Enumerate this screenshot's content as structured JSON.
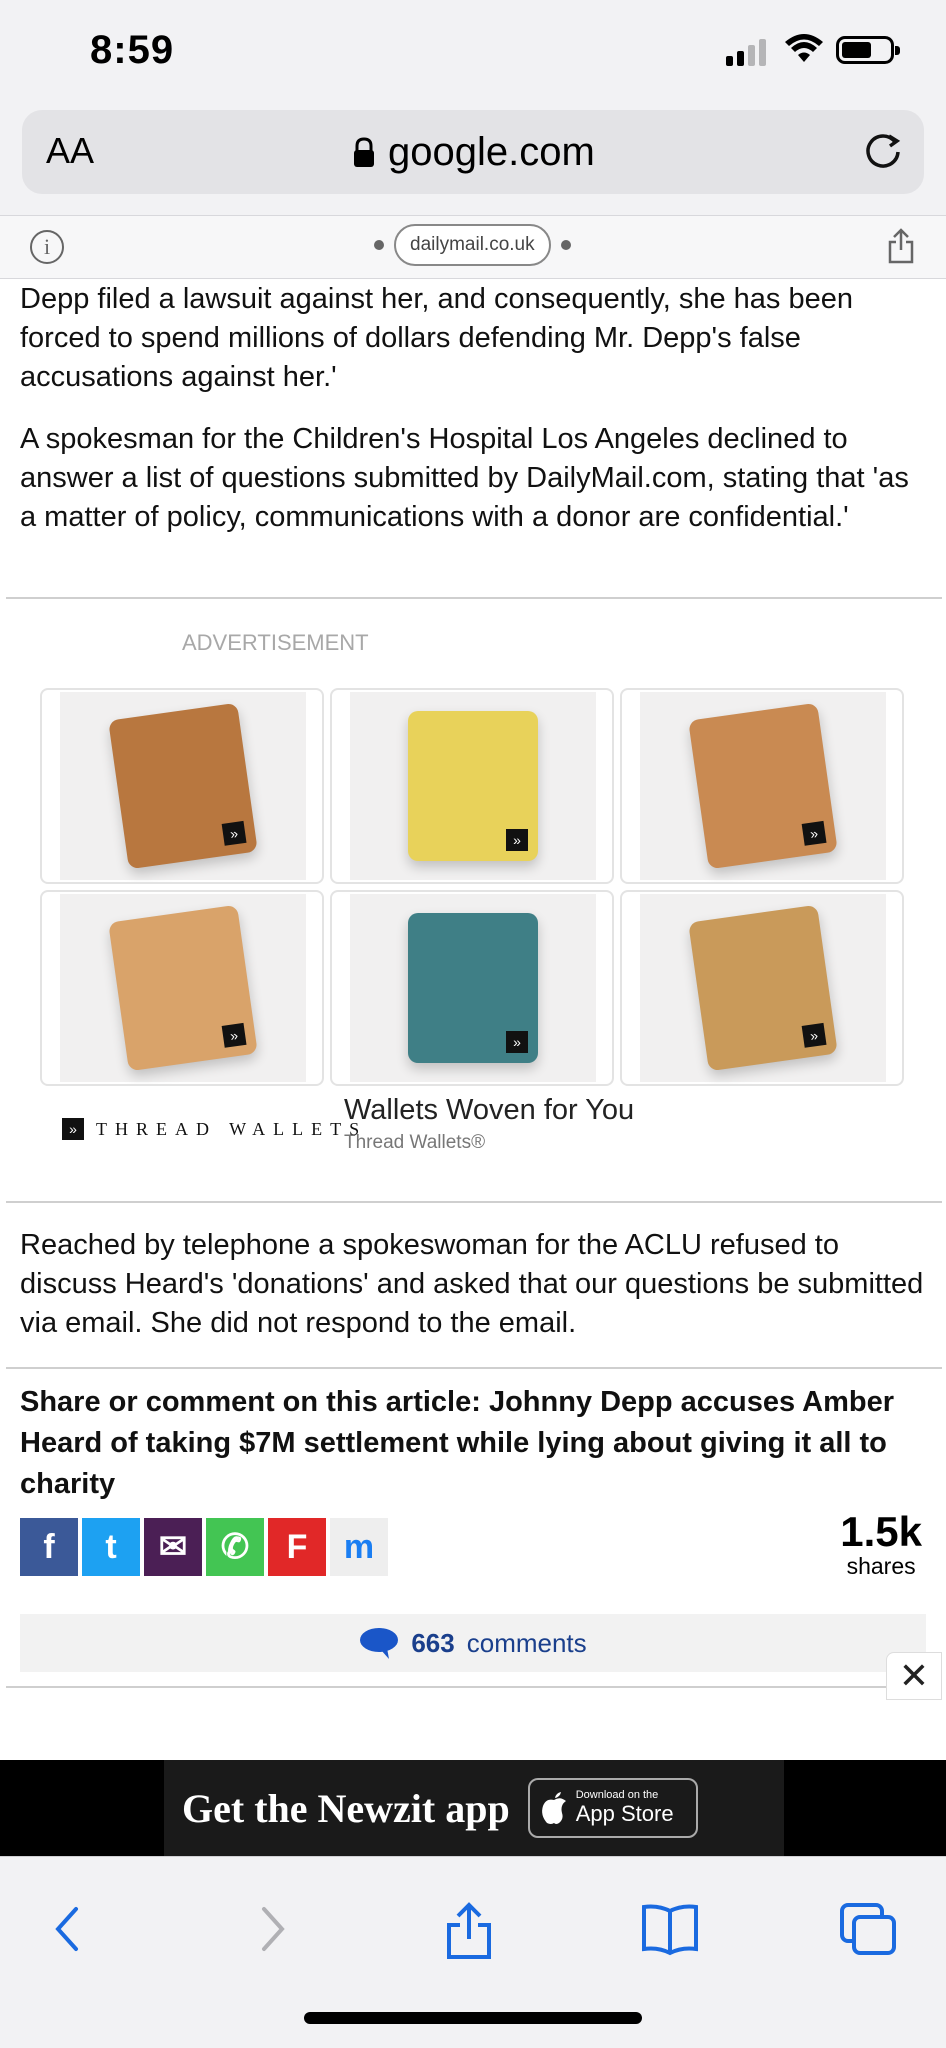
{
  "status": {
    "time": "8:59"
  },
  "browser": {
    "text_size_button": "AA",
    "url": "google.com",
    "site_pill": "dailymail.co.uk"
  },
  "article": {
    "p1": "Depp filed a lawsuit against her, and consequently, she has been forced to spend millions of dollars defending Mr. Depp's false accusations against her.'",
    "p2": "A spokesman for the Children's Hospital Los Angeles declined to answer a list of questions submitted by DailyMail.com, stating that 'as a matter of policy, communications with a donor are confidential.'",
    "p3": "Reached by telephone a spokeswoman for the ACLU refused to discuss Heard's 'donations' and asked that our questions be submitted via email. She did not respond to the email."
  },
  "ad": {
    "label": "ADVERTISEMENT",
    "brand": "THREAD WALLETS",
    "headline": "Wallets Woven for You",
    "advertiser": "Thread Wallets®",
    "products": [
      {
        "icon": "wallet-striped-red-icon",
        "color": "#b8773f"
      },
      {
        "icon": "keychain-wallet-pattern-icon",
        "color": "#e8d25a"
      },
      {
        "icon": "wallet-striped-orange-icon",
        "color": "#c98a52"
      },
      {
        "icon": "phone-case-floral-icon",
        "color": "#d9a36a"
      },
      {
        "icon": "sling-bag-teal-icon",
        "color": "#3f7f86"
      },
      {
        "icon": "keychain-wallet-leopard-icon",
        "color": "#c99a5a"
      }
    ]
  },
  "share": {
    "title": "Share or comment on this article: Johnny Depp accuses Amber Heard of taking $7M settlement while lying about giving it all to charity",
    "count": "1.5k",
    "count_label": "shares",
    "buttons": [
      {
        "icon": "facebook-icon",
        "glyph": "f",
        "color": "#3b5998"
      },
      {
        "icon": "twitter-icon",
        "glyph": "t",
        "color": "#1da1f2"
      },
      {
        "icon": "email-icon",
        "glyph": "✉",
        "color": "#4b1f55"
      },
      {
        "icon": "whatsapp-icon",
        "glyph": "✆",
        "color": "#43c553"
      },
      {
        "icon": "flipboard-icon",
        "glyph": "F",
        "color": "#e12828"
      },
      {
        "icon": "messenger-icon",
        "glyph": "m",
        "color": "#eeeeee"
      }
    ]
  },
  "comments": {
    "count": "663",
    "label": "comments"
  },
  "banner": {
    "text": "Get the Newzit app",
    "store_small": "Download on the",
    "store_big": "App Store"
  }
}
